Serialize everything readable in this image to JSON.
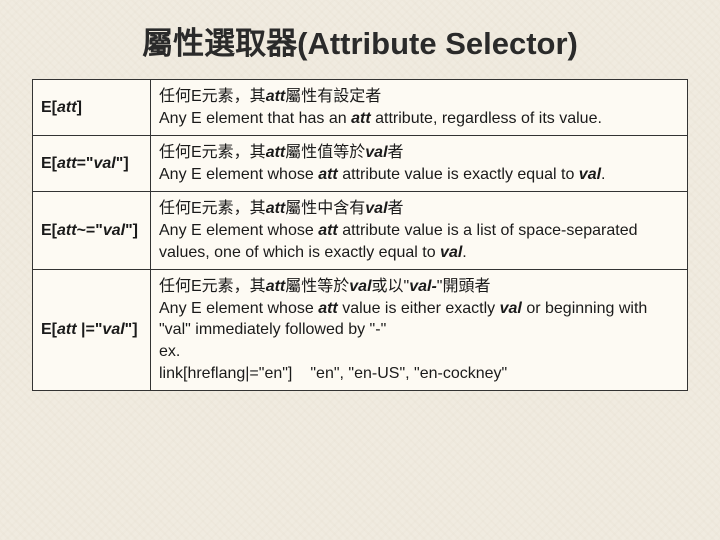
{
  "title": "屬性選取器(Attribute Selector)",
  "rows": [
    {
      "selector_pre": "E[",
      "selector_att": "att",
      "selector_post": "]",
      "zh_pre": "任何E元素，其",
      "zh_att": "att",
      "zh_mid": "屬性有設定者",
      "zh_val": "",
      "zh_post": "",
      "en_pre": "Any E element that has an ",
      "en_att": "att",
      "en_mid": " attribute, regardless of its value.",
      "en_val": "",
      "en_post": ""
    },
    {
      "selector_pre": "E[",
      "selector_att": "att",
      "selector_op": "=\"",
      "selector_val": "val",
      "selector_post": "\"]",
      "zh_pre": "任何E元素，其",
      "zh_att": "att",
      "zh_mid": "屬性值等於",
      "zh_val": "val",
      "zh_post": "者",
      "en_pre": "Any E element whose ",
      "en_att": "att",
      "en_mid": " attribute value is exactly equal to ",
      "en_val": "val",
      "en_post": "."
    },
    {
      "selector_pre": "E[",
      "selector_att": "att",
      "selector_op": "~=\"",
      "selector_val": "val",
      "selector_post": "\"]",
      "zh_pre": "任何E元素，其",
      "zh_att": "att",
      "zh_mid": "屬性中含有",
      "zh_val": "val",
      "zh_post": "者",
      "en_pre": "Any E element whose ",
      "en_att": "att",
      "en_mid": " attribute value is a list of space-separated values, one of which is exactly equal to ",
      "en_val": "val",
      "en_post": "."
    },
    {
      "selector_pre": "E[",
      "selector_att": "att",
      "selector_op": " |=\"",
      "selector_val": "val",
      "selector_post": "\"]",
      "zh_pre": "任何E元素，其",
      "zh_att": "att",
      "zh_mid": "屬性等於",
      "zh_val": "val",
      "zh_post": "或以\"",
      "zh_val2": "val-",
      "zh_tail": "\"開頭者",
      "en_pre": "Any E element whose ",
      "en_att": "att",
      "en_mid": " value is either exactly ",
      "en_val": "val",
      "en_post": " or beginning with \"val\" immediately followed by \"-\"",
      "ex_label": "ex.",
      "ex_code": "link[hreflang|=\"en\"]",
      "ex_vals": "\"en\", \"en-US\", \"en-cockney\""
    }
  ]
}
